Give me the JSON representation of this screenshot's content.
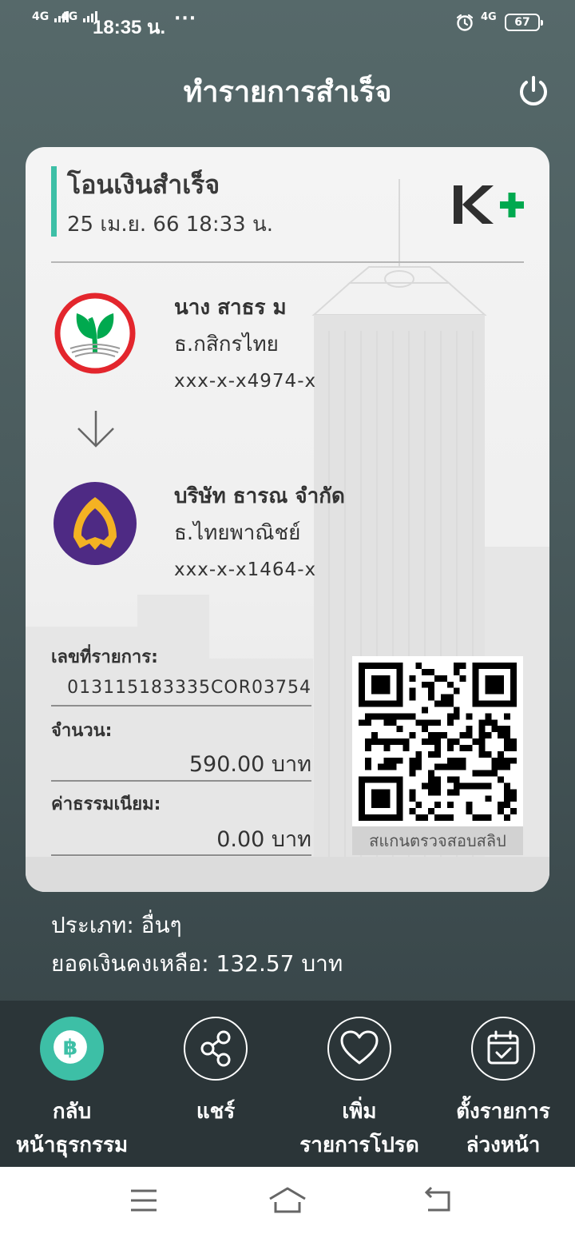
{
  "status_bar": {
    "signal1": "4G",
    "signal2": "4G",
    "time": "18:35 น.",
    "more": "···",
    "network": "4G",
    "battery": "67"
  },
  "header": {
    "title": "ทำรายการสำเร็จ",
    "power_icon": "power-icon"
  },
  "receipt": {
    "title": "โอนเงินสำเร็จ",
    "datetime": "25 เม.ย. 66  18:33 น.",
    "brand": "K+",
    "sender": {
      "name": "นาง สาธร ม",
      "bank": "ธ.กสิกรไทย",
      "account": "xxx-x-x4974-x"
    },
    "receiver": {
      "name": "บริษัท ธารณ จำกัด",
      "bank": "ธ.ไทยพาณิชย์",
      "account": "xxx-x-x1464-x"
    },
    "ref_label": "เลขที่รายการ:",
    "ref_value": "013115183335COR03754",
    "amount_label": "จำนวน:",
    "amount_value": "590.00 บาท",
    "fee_label": "ค่าธรรมเนียม:",
    "fee_value": "0.00 บาท",
    "qr_caption": "สแกนตรวจสอบสลิป",
    "colors": {
      "accent": "#3dbfa6",
      "kbank_green": "#00a94f",
      "kbank_red": "#e3262d",
      "scb_purple": "#4e2a84",
      "scb_gold": "#f4b223"
    }
  },
  "info": {
    "type_line": "ประเภท: อื่นๆ",
    "balance_line": "ยอดเงินคงเหลือ: 132.57 บาท"
  },
  "actions": [
    {
      "line1": "กลับ",
      "line2": "หน้าธุรกรรม",
      "icon": "baht-icon"
    },
    {
      "line1": "แชร์",
      "line2": "",
      "icon": "share-icon"
    },
    {
      "line1": "เพิ่ม",
      "line2": "รายการโปรด",
      "icon": "heart-icon"
    },
    {
      "line1": "ตั้งรายการ",
      "line2": "ล่วงหน้า",
      "icon": "calendar-check-icon"
    }
  ],
  "nav": [
    "menu-icon",
    "home-icon",
    "back-icon"
  ]
}
